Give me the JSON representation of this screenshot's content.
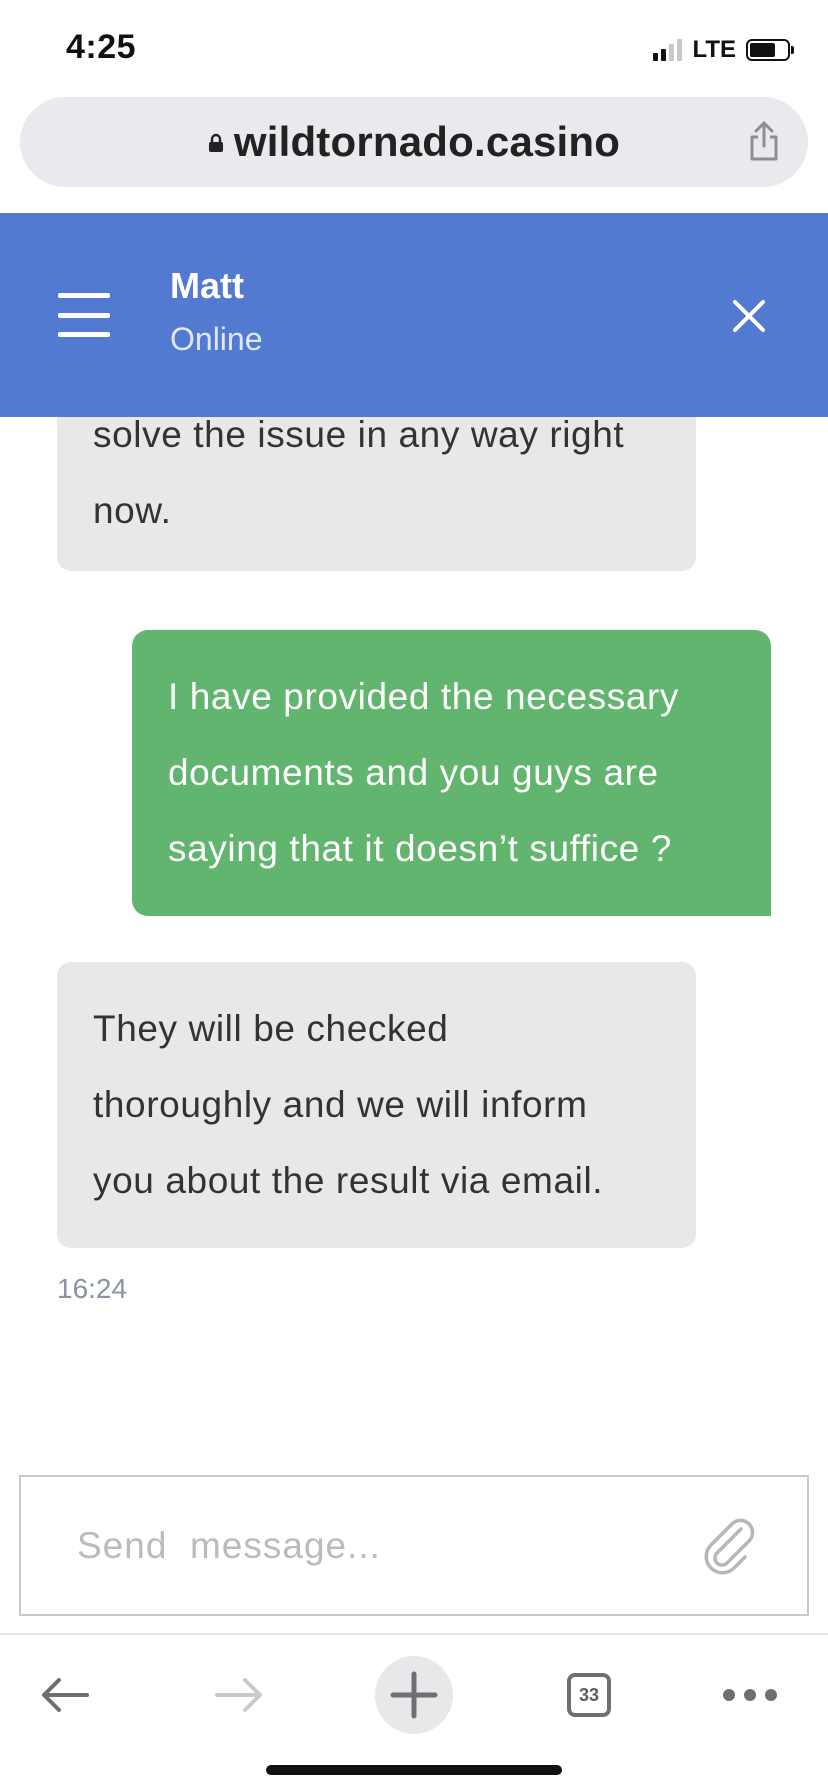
{
  "status_bar": {
    "time": "4:25",
    "network": "LTE",
    "signal_bars": 4,
    "signal_bars_active": 2
  },
  "browser": {
    "url": "wildtornado.casino",
    "lock_icon": "lock-icon",
    "share_icon": "share-icon"
  },
  "chat": {
    "agent_name": "Matt",
    "agent_status": "Online",
    "colors": {
      "header": "#527ad1",
      "agent_bubble": "#e8e8e9",
      "user_bubble": "#62b56e"
    },
    "messages": [
      {
        "sender": "agent",
        "lines": [
          "solve the issue in any way right",
          "now."
        ]
      },
      {
        "sender": "user",
        "lines": [
          "I have provided the necessary",
          "documents and you guys are",
          "saying that it doesn’t suffice ?"
        ]
      },
      {
        "sender": "agent",
        "lines": [
          "They will be checked",
          "thoroughly and we will inform",
          "you about the result via email."
        ]
      }
    ],
    "last_timestamp": "16:24"
  },
  "composer": {
    "placeholder": "Send  message..."
  },
  "toolbar": {
    "tab_count": "33"
  }
}
